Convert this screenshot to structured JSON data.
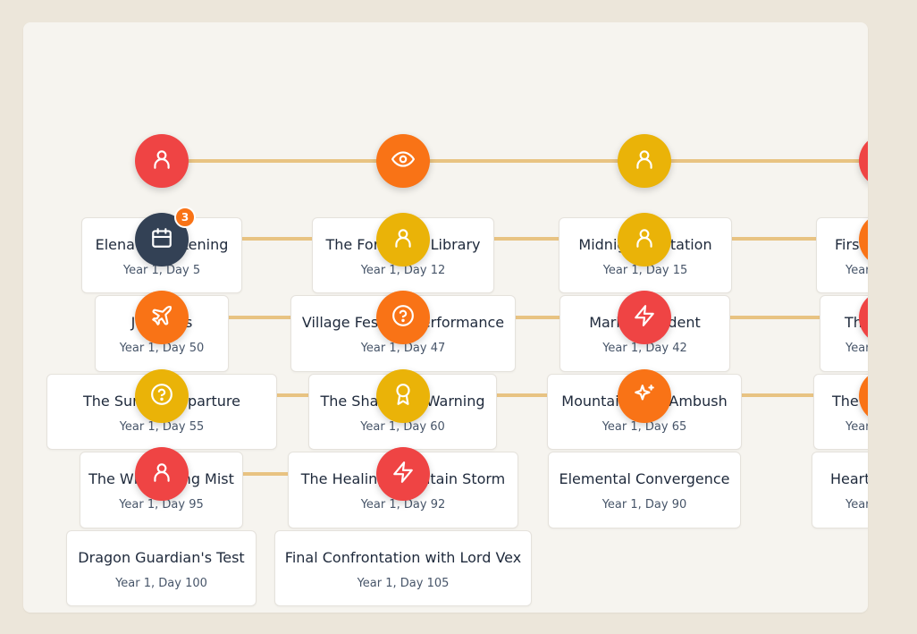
{
  "top_nodes": [
    {
      "icon": "user-icon",
      "color": "#ef4444"
    },
    {
      "icon": "eye-icon",
      "color": "#f97316"
    },
    {
      "icon": "user-icon",
      "color": "#eab308"
    },
    {
      "icon": "user-icon",
      "color": "#ef4444"
    }
  ],
  "events": [
    {
      "title": "Elena's Awakening",
      "date": "Year 1, Day 5",
      "icon": "calendar-icon",
      "badge": "3"
    },
    {
      "title": "The Forgotten Library",
      "date": "Year 1, Day 12",
      "icon": "user-icon"
    },
    {
      "title": "Midnight Visitation",
      "date": "Year 1, Day 15",
      "icon": "user-icon"
    },
    {
      "title": "First",
      "date": "Year",
      "icon": "user-icon"
    },
    {
      "title": "Journeys",
      "date": "Year 1, Day 50",
      "icon": "plane-icon"
    },
    {
      "title": "Village Festival Performance",
      "date": "Year 1, Day 47",
      "icon": "help-circle-icon"
    },
    {
      "title": "Market Incident",
      "date": "Year 1, Day 42",
      "icon": "lightning-icon"
    },
    {
      "title": "Th",
      "date": "Year",
      "icon": "user-icon"
    },
    {
      "title": "The Sunset Departure",
      "date": "Year 1, Day 55",
      "icon": "help-circle-icon"
    },
    {
      "title": "The Shaman's Warning",
      "date": "Year 1, Day 60",
      "icon": "award-icon"
    },
    {
      "title": "Mountain Pass Ambush",
      "date": "Year 1, Day 65",
      "icon": "sparkles-icon"
    },
    {
      "title": "The",
      "date": "Year",
      "icon": "user-icon"
    },
    {
      "title": "The Whispering Mist",
      "date": "Year 1, Day 95",
      "icon": "user-icon"
    },
    {
      "title": "The Healing Mountain Storm",
      "date": "Year 1, Day 92",
      "icon": "lightning-icon"
    },
    {
      "title": "Elemental Convergence",
      "date": "Year 1, Day 90"
    },
    {
      "title": "Heart",
      "date": "Year"
    },
    {
      "title": "Dragon Guardian's Test",
      "date": "Year 1, Day 100"
    },
    {
      "title": "Final Confrontation with Lord Vex",
      "date": "Year 1, Day 105"
    }
  ],
  "colors": {
    "red": "#ef4444",
    "orange": "#f97316",
    "yellow": "#eab308",
    "dark": "#334155",
    "connector": "#e8c382"
  }
}
